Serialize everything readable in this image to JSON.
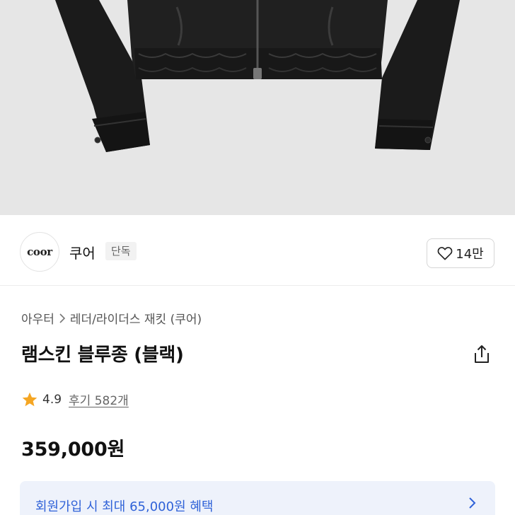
{
  "brand": {
    "logo_text": "coor",
    "name": "쿠어",
    "badge": "단독",
    "like_count": "14만"
  },
  "breadcrumb": {
    "category": "아우터",
    "subcategory": "레더/라이더스 재킷 (쿠어)"
  },
  "product": {
    "title": "램스킨 블루종 (블랙)",
    "rating": "4.9",
    "review_label": "후기 582개",
    "price": "359,000원"
  },
  "banner": {
    "text": "회원가입 시 최대 65,000원 혜택"
  },
  "colors": {
    "banner_text": "#2f62d8",
    "banner_bg": "#eef2fb",
    "star": "#f5a623"
  },
  "icons": [
    "heart-icon",
    "chevron-right-icon",
    "share-icon",
    "star-icon"
  ]
}
